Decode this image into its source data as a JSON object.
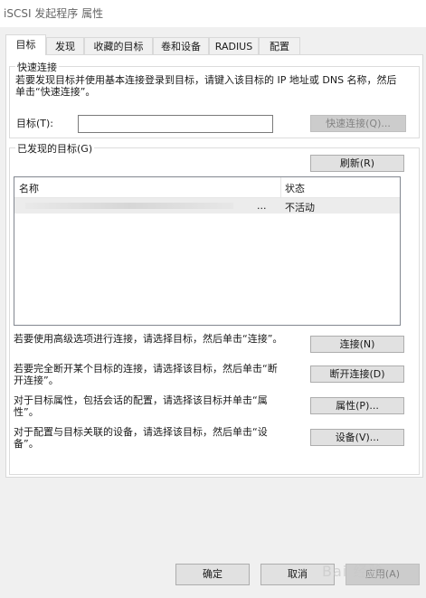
{
  "window": {
    "title": "iSCSI 发起程序 属性"
  },
  "tabs": [
    {
      "label": "目标"
    },
    {
      "label": "发现"
    },
    {
      "label": "收藏的目标"
    },
    {
      "label": "卷和设备"
    },
    {
      "label": "RADIUS"
    },
    {
      "label": "配置"
    }
  ],
  "quick_connect": {
    "group_title": "快速连接",
    "description": "若要发现目标并使用基本连接登录到目标，请键入该目标的 IP 地址或 DNS 名称，然后单击“快速连接”。",
    "target_label": "目标(T):",
    "target_value": "",
    "button_label": "快速连接(Q)..."
  },
  "discovered": {
    "group_title": "已发现的目标(G)",
    "refresh_label": "刷新(R)",
    "columns": {
      "name": "名称",
      "status": "状态"
    },
    "rows": [
      {
        "name": "...",
        "status": "不活动"
      }
    ]
  },
  "actions": [
    {
      "description": "若要使用高级选项进行连接，请选择目标，然后单击“连接”。",
      "button": "连接(N)"
    },
    {
      "description": "若要完全断开某个目标的连接，请选择该目标，然后单击“断开连接”。",
      "button": "断开连接(D)"
    },
    {
      "description": "对于目标属性，包括会话的配置，请选择该目标并单击“属性”。",
      "button": "属性(P)..."
    },
    {
      "description": "对于配置与目标关联的设备，请选择该目标，然后单击“设备”。",
      "button": "设备(V)..."
    }
  ],
  "footer": {
    "ok": "确定",
    "cancel": "取消",
    "apply": "应用(A)"
  },
  "watermark": "Bai 经验",
  "colors": {
    "window_bg": "#f0f0f0",
    "panel_bg": "#ffffff",
    "selected_row": "#ececec",
    "button_bg": "#e1e1e1",
    "disabled_button_bg": "#cccccc"
  }
}
